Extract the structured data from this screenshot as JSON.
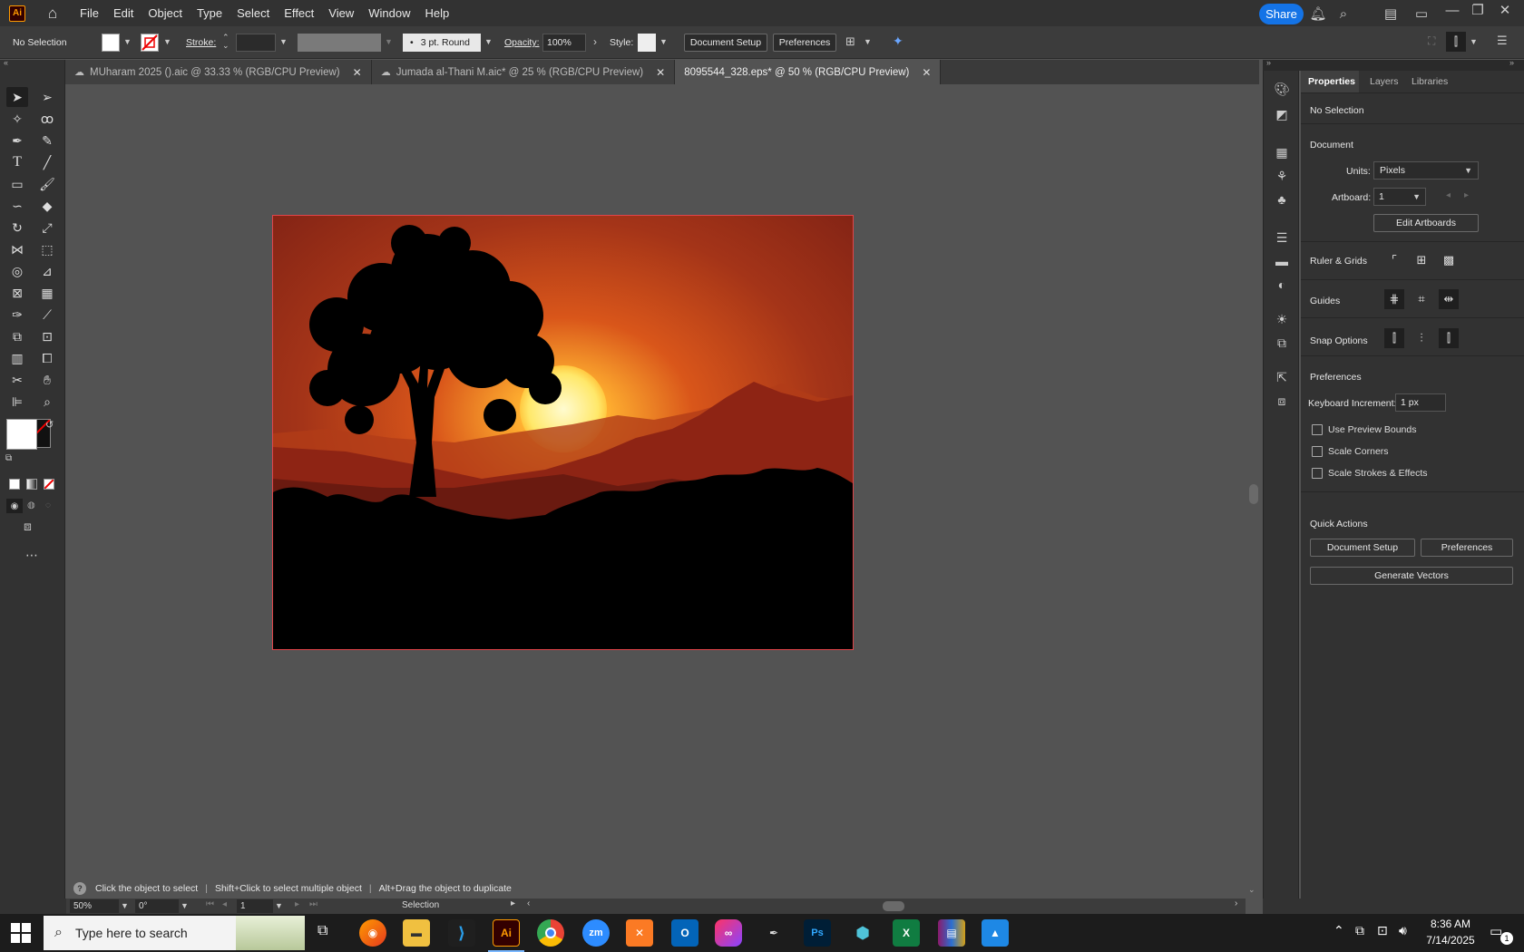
{
  "menu": {
    "app_logo": "Ai",
    "items": [
      "File",
      "Edit",
      "Object",
      "Type",
      "Select",
      "Effect",
      "View",
      "Window",
      "Help"
    ],
    "share_label": "Share"
  },
  "control_bar": {
    "selection": "No Selection",
    "stroke_label": "Stroke:",
    "brush_value": "3 pt. Round",
    "opacity_label": "Opacity:",
    "opacity_value": "100%",
    "style_label": "Style:",
    "document_setup": "Document Setup",
    "preferences": "Preferences"
  },
  "tabs": [
    {
      "label": "MUharam 2025 ().aic @ 33.33 % (RGB/CPU Preview)",
      "active": false,
      "cloud": true
    },
    {
      "label": "Jumada al-Thani M.aic* @ 25 % (RGB/CPU Preview)",
      "active": false,
      "cloud": true
    },
    {
      "label": "8095544_328.eps* @ 50 % (RGB/CPU Preview)",
      "active": true,
      "cloud": false
    }
  ],
  "properties": {
    "tabs": [
      "Properties",
      "Layers",
      "Libraries"
    ],
    "no_selection": "No Selection",
    "document": "Document",
    "units_label": "Units:",
    "units_value": "Pixels",
    "artboard_label": "Artboard:",
    "artboard_value": "1",
    "edit_artboards": "Edit Artboards",
    "ruler_grids": "Ruler & Grids",
    "guides": "Guides",
    "snap_options": "Snap Options",
    "preferences": "Preferences",
    "keyboard_increment_label": "Keyboard Increment:",
    "keyboard_increment_value": "1 px",
    "use_preview_bounds": "Use Preview Bounds",
    "scale_corners": "Scale Corners",
    "scale_strokes": "Scale Strokes & Effects",
    "quick_actions": "Quick Actions",
    "document_setup": "Document Setup",
    "preferences_btn": "Preferences",
    "generate_vectors": "Generate Vectors"
  },
  "hint": {
    "part1": "Click the object to select",
    "part2": "Shift+Click to select multiple object",
    "part3": "Alt+Drag the object to duplicate"
  },
  "status": {
    "zoom": "50%",
    "rotation": "0°",
    "artboard_nav": "1",
    "tool": "Selection"
  },
  "taskbar": {
    "search_placeholder": "Type here to search",
    "time": "8:36 AM",
    "date": "7/14/2025",
    "notifications": "1",
    "apps": [
      "firefox-icon",
      "file-explorer-icon",
      "vscode-icon",
      "illustrator-icon",
      "chrome-icon",
      "zoom-icon",
      "xampp-icon",
      "outlook-icon",
      "creative-cloud-icon",
      "inkscape-icon",
      "photoshop-icon",
      "app-icon",
      "excel-icon",
      "winrar-icon",
      "paint-icon"
    ]
  },
  "colors": {
    "accent": "#1473e6",
    "artboard_border": "#e0454a",
    "sky_top": "#7a1f14",
    "sun": "#fff4a0"
  }
}
